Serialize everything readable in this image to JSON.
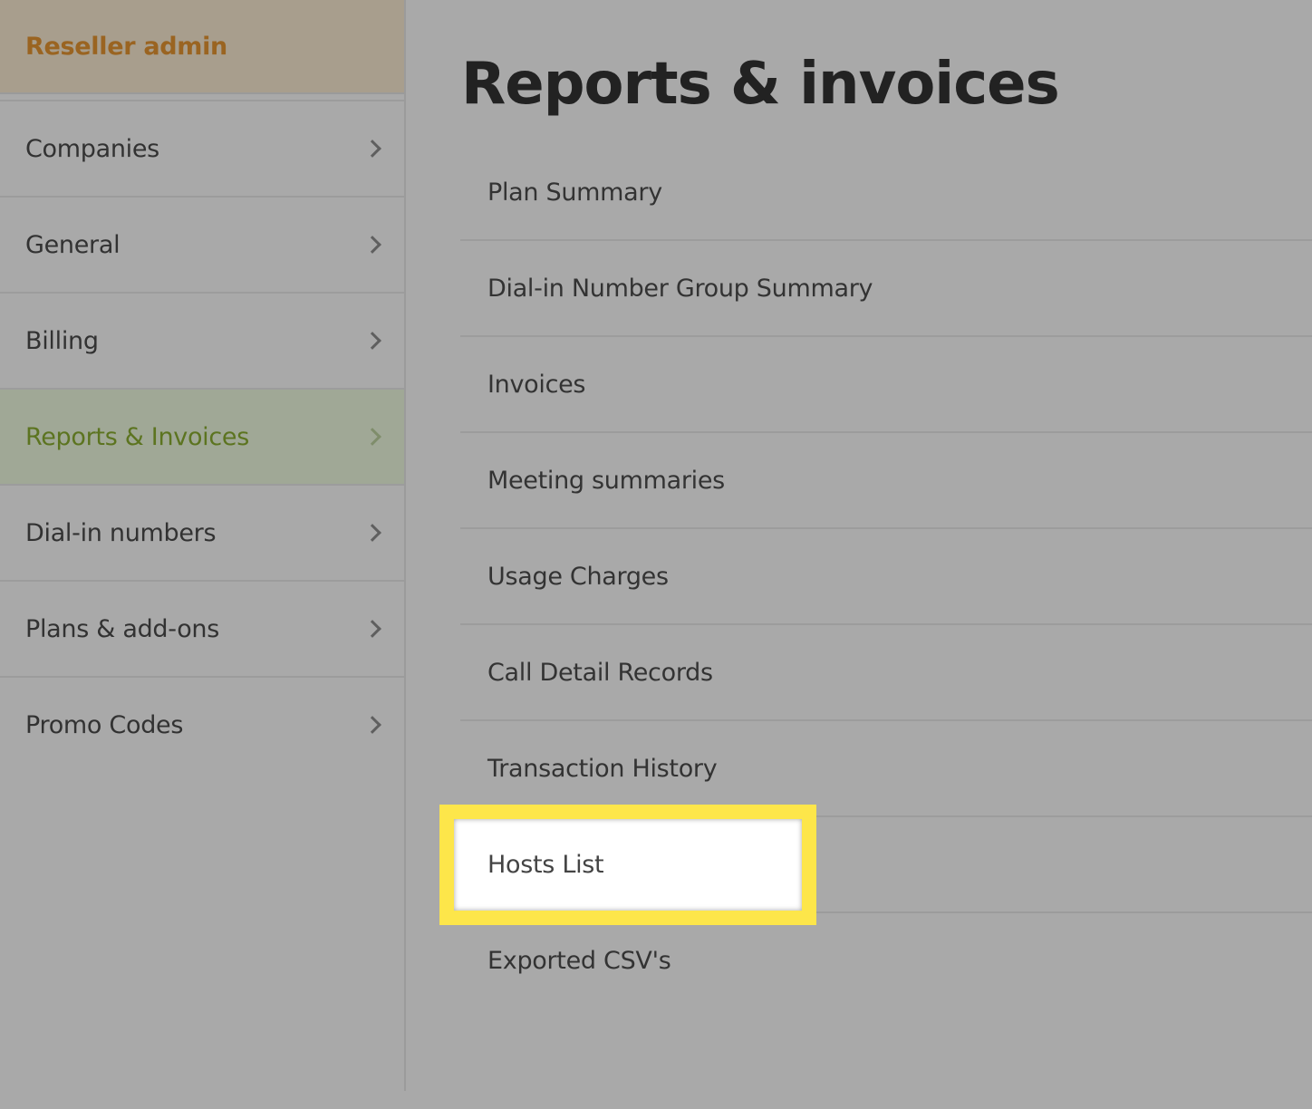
{
  "sidebar": {
    "header": "Reseller admin",
    "items": [
      {
        "label": "Companies"
      },
      {
        "label": "General"
      },
      {
        "label": "Billing"
      },
      {
        "label": "Reports & Invoices"
      },
      {
        "label": "Dial-in numbers"
      },
      {
        "label": "Plans & add-ons"
      },
      {
        "label": "Promo Codes"
      }
    ],
    "active_item": "Reports & Invoices"
  },
  "main": {
    "title": "Reports & invoices",
    "reports": [
      {
        "label": "Plan Summary"
      },
      {
        "label": "Dial-in Number Group Summary"
      },
      {
        "label": "Invoices"
      },
      {
        "label": "Meeting summaries"
      },
      {
        "label": "Usage Charges"
      },
      {
        "label": "Call Detail Records"
      },
      {
        "label": "Transaction History"
      },
      {
        "label": "Hosts List"
      },
      {
        "label": "Exported CSV's"
      }
    ],
    "highlighted_item": "Hosts List"
  },
  "colors": {
    "background": "#a9a9a9",
    "header_text": "#9a6421",
    "active_text": "#5c7420",
    "highlight_border": "#fde64a"
  }
}
